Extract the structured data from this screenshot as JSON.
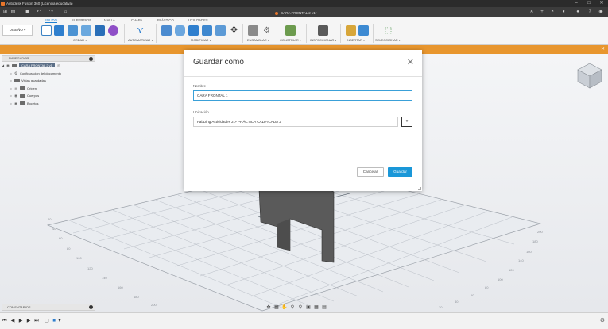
{
  "window": {
    "title": "Autodesk Fusion 360 (Licencia educativa)",
    "minimize_icon": "minimize-icon",
    "maximize_icon": "maximize-icon",
    "close_icon": "close-icon"
  },
  "document_tab": {
    "title": "CARA FRONTAL 2 v1*"
  },
  "ribbon": {
    "workspace_label": "DISEÑO ▾",
    "tabs": [
      "SÓLIDO",
      "SUPERFICIE",
      "MALLA",
      "CHAPA",
      "PLÁSTICO",
      "UTILIDADES"
    ],
    "active_tab": "SÓLIDO",
    "groups": [
      "CREAR ▾",
      "AUTOMATIZAR ▾",
      "MODIFICAR ▾",
      "ENSAMBLAR ▾",
      "CONSTRUIR ▾",
      "INSPECCIONAR ▾",
      "INSERTAR ▾",
      "SELECCIONAR ▾"
    ]
  },
  "banner": {
    "color": "#e8962e"
  },
  "browser": {
    "header": "NAVEGADOR",
    "root": "CARA FRONTAL 2 v1",
    "items": [
      "Configuración del documento",
      "Vistas guardadas",
      "Origen",
      "Cuerpos",
      "Bocetos"
    ]
  },
  "comments": {
    "label": "COMENTARIOS"
  },
  "dialog": {
    "title": "Guardar como",
    "name_label": "Nombre",
    "name_value": "CARA FRONTAL 1",
    "location_label": "Ubicación",
    "location_value": "FabDing Actividades 2 > PRÁCTICA CALIFICADA 2",
    "cancel_label": "Cancelar",
    "save_label": "Guardar"
  },
  "grid_ticks_left": [
    "200",
    "180",
    "160",
    "140",
    "120",
    "100",
    "80",
    "60",
    "40",
    "20"
  ],
  "grid_ticks_right": [
    "200",
    "180",
    "160",
    "140",
    "120",
    "100",
    "80",
    "60",
    "40",
    "20"
  ],
  "colors": {
    "accent": "#1a97d8",
    "orange": "#e8962e",
    "part": "#5a5a5a"
  }
}
